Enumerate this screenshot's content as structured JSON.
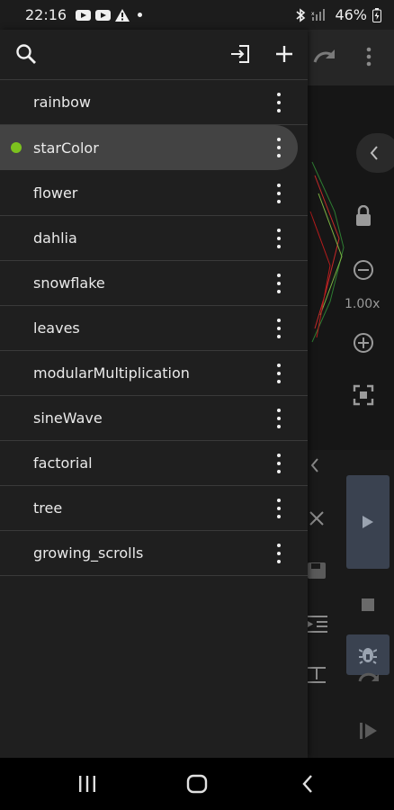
{
  "status_bar": {
    "time": "22:16",
    "battery": "46%"
  },
  "editor": {
    "zoom_level": "1.00x"
  },
  "drawer": {
    "header_icons": [
      "search-icon",
      "import-icon",
      "add-icon"
    ],
    "accent_color": "#7cc21e",
    "items": [
      {
        "label": "rainbow"
      },
      {
        "label": "starColor"
      },
      {
        "label": "flower"
      },
      {
        "label": "dahlia"
      },
      {
        "label": "snowflake"
      },
      {
        "label": "leaves"
      },
      {
        "label": "modularMultiplication"
      },
      {
        "label": "sineWave"
      },
      {
        "label": "factorial"
      },
      {
        "label": "tree"
      },
      {
        "label": "growing_scrolls"
      }
    ],
    "active_index": 1
  },
  "nav_bar": {
    "icons": [
      "recents-icon",
      "home-icon",
      "back-icon"
    ]
  }
}
